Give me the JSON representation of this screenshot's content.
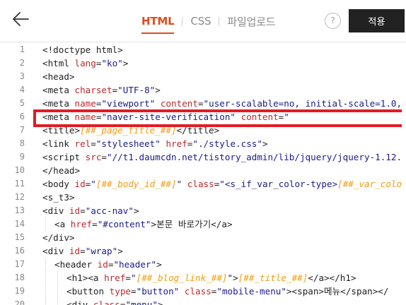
{
  "toolbar": {
    "tabs": [
      {
        "label": "HTML",
        "active": true
      },
      {
        "label": "CSS",
        "active": false
      },
      {
        "label": "파일업로드",
        "active": false
      }
    ],
    "help_label": "?",
    "apply_label": "적용",
    "accent_color": "#e64a19"
  },
  "editor": {
    "highlighted_line": 6,
    "lines": [
      {
        "n": "1",
        "indent": 0,
        "tokens": [
          [
            "tg",
            "<!doctype html>"
          ]
        ]
      },
      {
        "n": "2",
        "indent": 0,
        "tokens": [
          [
            "tg",
            "<html "
          ],
          [
            "at",
            "lang"
          ],
          [
            "eq",
            "="
          ],
          [
            "st",
            "\"ko\""
          ],
          [
            "tg",
            ">"
          ]
        ]
      },
      {
        "n": "3",
        "indent": 0,
        "tokens": [
          [
            "tg",
            "<head>"
          ]
        ]
      },
      {
        "n": "4",
        "indent": 0,
        "tokens": [
          [
            "tg",
            "<meta "
          ],
          [
            "at",
            "charset"
          ],
          [
            "eq",
            "="
          ],
          [
            "st",
            "\"UTF-8\""
          ],
          [
            "tg",
            ">"
          ]
        ]
      },
      {
        "n": "5",
        "indent": 0,
        "tokens": [
          [
            "tg",
            "<meta "
          ],
          [
            "at",
            "name"
          ],
          [
            "eq",
            "="
          ],
          [
            "st",
            "\"viewport\""
          ],
          [
            "tg",
            " "
          ],
          [
            "at",
            "content"
          ],
          [
            "eq",
            "="
          ],
          [
            "st",
            "\"user-scalable=no, initial-scale=1.0,"
          ]
        ]
      },
      {
        "n": "6",
        "indent": 0,
        "tokens": [
          [
            "tg",
            "<meta "
          ],
          [
            "at",
            "name"
          ],
          [
            "eq",
            "="
          ],
          [
            "st",
            "\"naver-site-verification\""
          ],
          [
            "tg",
            " "
          ],
          [
            "at",
            "content"
          ],
          [
            "eq",
            "="
          ],
          [
            "st",
            "\""
          ]
        ]
      },
      {
        "n": "7",
        "indent": 0,
        "tokens": [
          [
            "tg",
            "<title>"
          ],
          [
            "ph",
            "[##_page_title_##]"
          ],
          [
            "tg",
            "</title>"
          ]
        ]
      },
      {
        "n": "8",
        "indent": 0,
        "tokens": [
          [
            "tg",
            "<link "
          ],
          [
            "at",
            "rel"
          ],
          [
            "eq",
            "="
          ],
          [
            "st",
            "\"stylesheet\""
          ],
          [
            "tg",
            " "
          ],
          [
            "at",
            "href"
          ],
          [
            "eq",
            "="
          ],
          [
            "st",
            "\"./style.css\""
          ],
          [
            "tg",
            ">"
          ]
        ]
      },
      {
        "n": "9",
        "indent": 0,
        "tokens": [
          [
            "tg",
            "<script "
          ],
          [
            "at",
            "src"
          ],
          [
            "eq",
            "="
          ],
          [
            "st",
            "\"//t1.daumcdn.net/tistory_admin/lib/jquery/jquery-1.12."
          ]
        ]
      },
      {
        "n": "10",
        "indent": 0,
        "tokens": [
          [
            "tg",
            "</head>"
          ]
        ]
      },
      {
        "n": "11",
        "indent": 0,
        "tokens": [
          [
            "tg",
            "<body "
          ],
          [
            "at",
            "id"
          ],
          [
            "eq",
            "="
          ],
          [
            "st",
            "\""
          ],
          [
            "ph",
            "[##_body_id_##]"
          ],
          [
            "st",
            "\""
          ],
          [
            "tg",
            " "
          ],
          [
            "at",
            "class"
          ],
          [
            "eq",
            "="
          ],
          [
            "st",
            "\"<s_if_var_color-type>"
          ],
          [
            "ph",
            "[##_var_colo"
          ]
        ]
      },
      {
        "n": "12",
        "indent": 0,
        "tokens": [
          [
            "tg",
            "<s_t3>"
          ]
        ]
      },
      {
        "n": "13",
        "indent": 0,
        "tokens": [
          [
            "tg",
            "<div "
          ],
          [
            "at",
            "id"
          ],
          [
            "eq",
            "="
          ],
          [
            "st",
            "\"acc-nav\""
          ],
          [
            "tg",
            ">"
          ]
        ]
      },
      {
        "n": "14",
        "indent": 1,
        "tokens": [
          [
            "tg",
            "<a "
          ],
          [
            "at",
            "href"
          ],
          [
            "eq",
            "="
          ],
          [
            "st",
            "\"#content\""
          ],
          [
            "tg",
            ">"
          ],
          [
            "tx",
            "본문 바로가기"
          ],
          [
            "tg",
            "</a>"
          ]
        ]
      },
      {
        "n": "15",
        "indent": 0,
        "tokens": [
          [
            "tg",
            "</div>"
          ]
        ]
      },
      {
        "n": "16",
        "indent": 0,
        "tokens": [
          [
            "tg",
            "<div "
          ],
          [
            "at",
            "id"
          ],
          [
            "eq",
            "="
          ],
          [
            "st",
            "\"wrap\""
          ],
          [
            "tg",
            ">"
          ]
        ]
      },
      {
        "n": "17",
        "indent": 1,
        "tokens": [
          [
            "tg",
            "<header "
          ],
          [
            "at",
            "id"
          ],
          [
            "eq",
            "="
          ],
          [
            "st",
            "\"header\""
          ],
          [
            "tg",
            ">"
          ]
        ]
      },
      {
        "n": "18",
        "indent": 2,
        "tokens": [
          [
            "tg",
            "<h1><a "
          ],
          [
            "at",
            "href"
          ],
          [
            "eq",
            "="
          ],
          [
            "st",
            "\""
          ],
          [
            "ph",
            "[##_blog_link_##]"
          ],
          [
            "st",
            "\""
          ],
          [
            "tg",
            ">"
          ],
          [
            "ph",
            "[##_title_##]"
          ],
          [
            "tg",
            "</a></h1>"
          ]
        ]
      },
      {
        "n": "19",
        "indent": 2,
        "tokens": [
          [
            "tg",
            "<button "
          ],
          [
            "at",
            "type"
          ],
          [
            "eq",
            "="
          ],
          [
            "st",
            "\"button\""
          ],
          [
            "tg",
            " "
          ],
          [
            "at",
            "class"
          ],
          [
            "eq",
            "="
          ],
          [
            "st",
            "\"mobile-menu\""
          ],
          [
            "tg",
            "><span>"
          ],
          [
            "tx",
            "메뉴"
          ],
          [
            "tg",
            "</span></"
          ]
        ]
      },
      {
        "n": "20",
        "indent": 2,
        "tokens": [
          [
            "tg",
            "<div "
          ],
          [
            "at",
            "class"
          ],
          [
            "eq",
            "="
          ],
          [
            "st",
            "\"menu\""
          ],
          [
            "tg",
            ">"
          ]
        ]
      }
    ]
  }
}
